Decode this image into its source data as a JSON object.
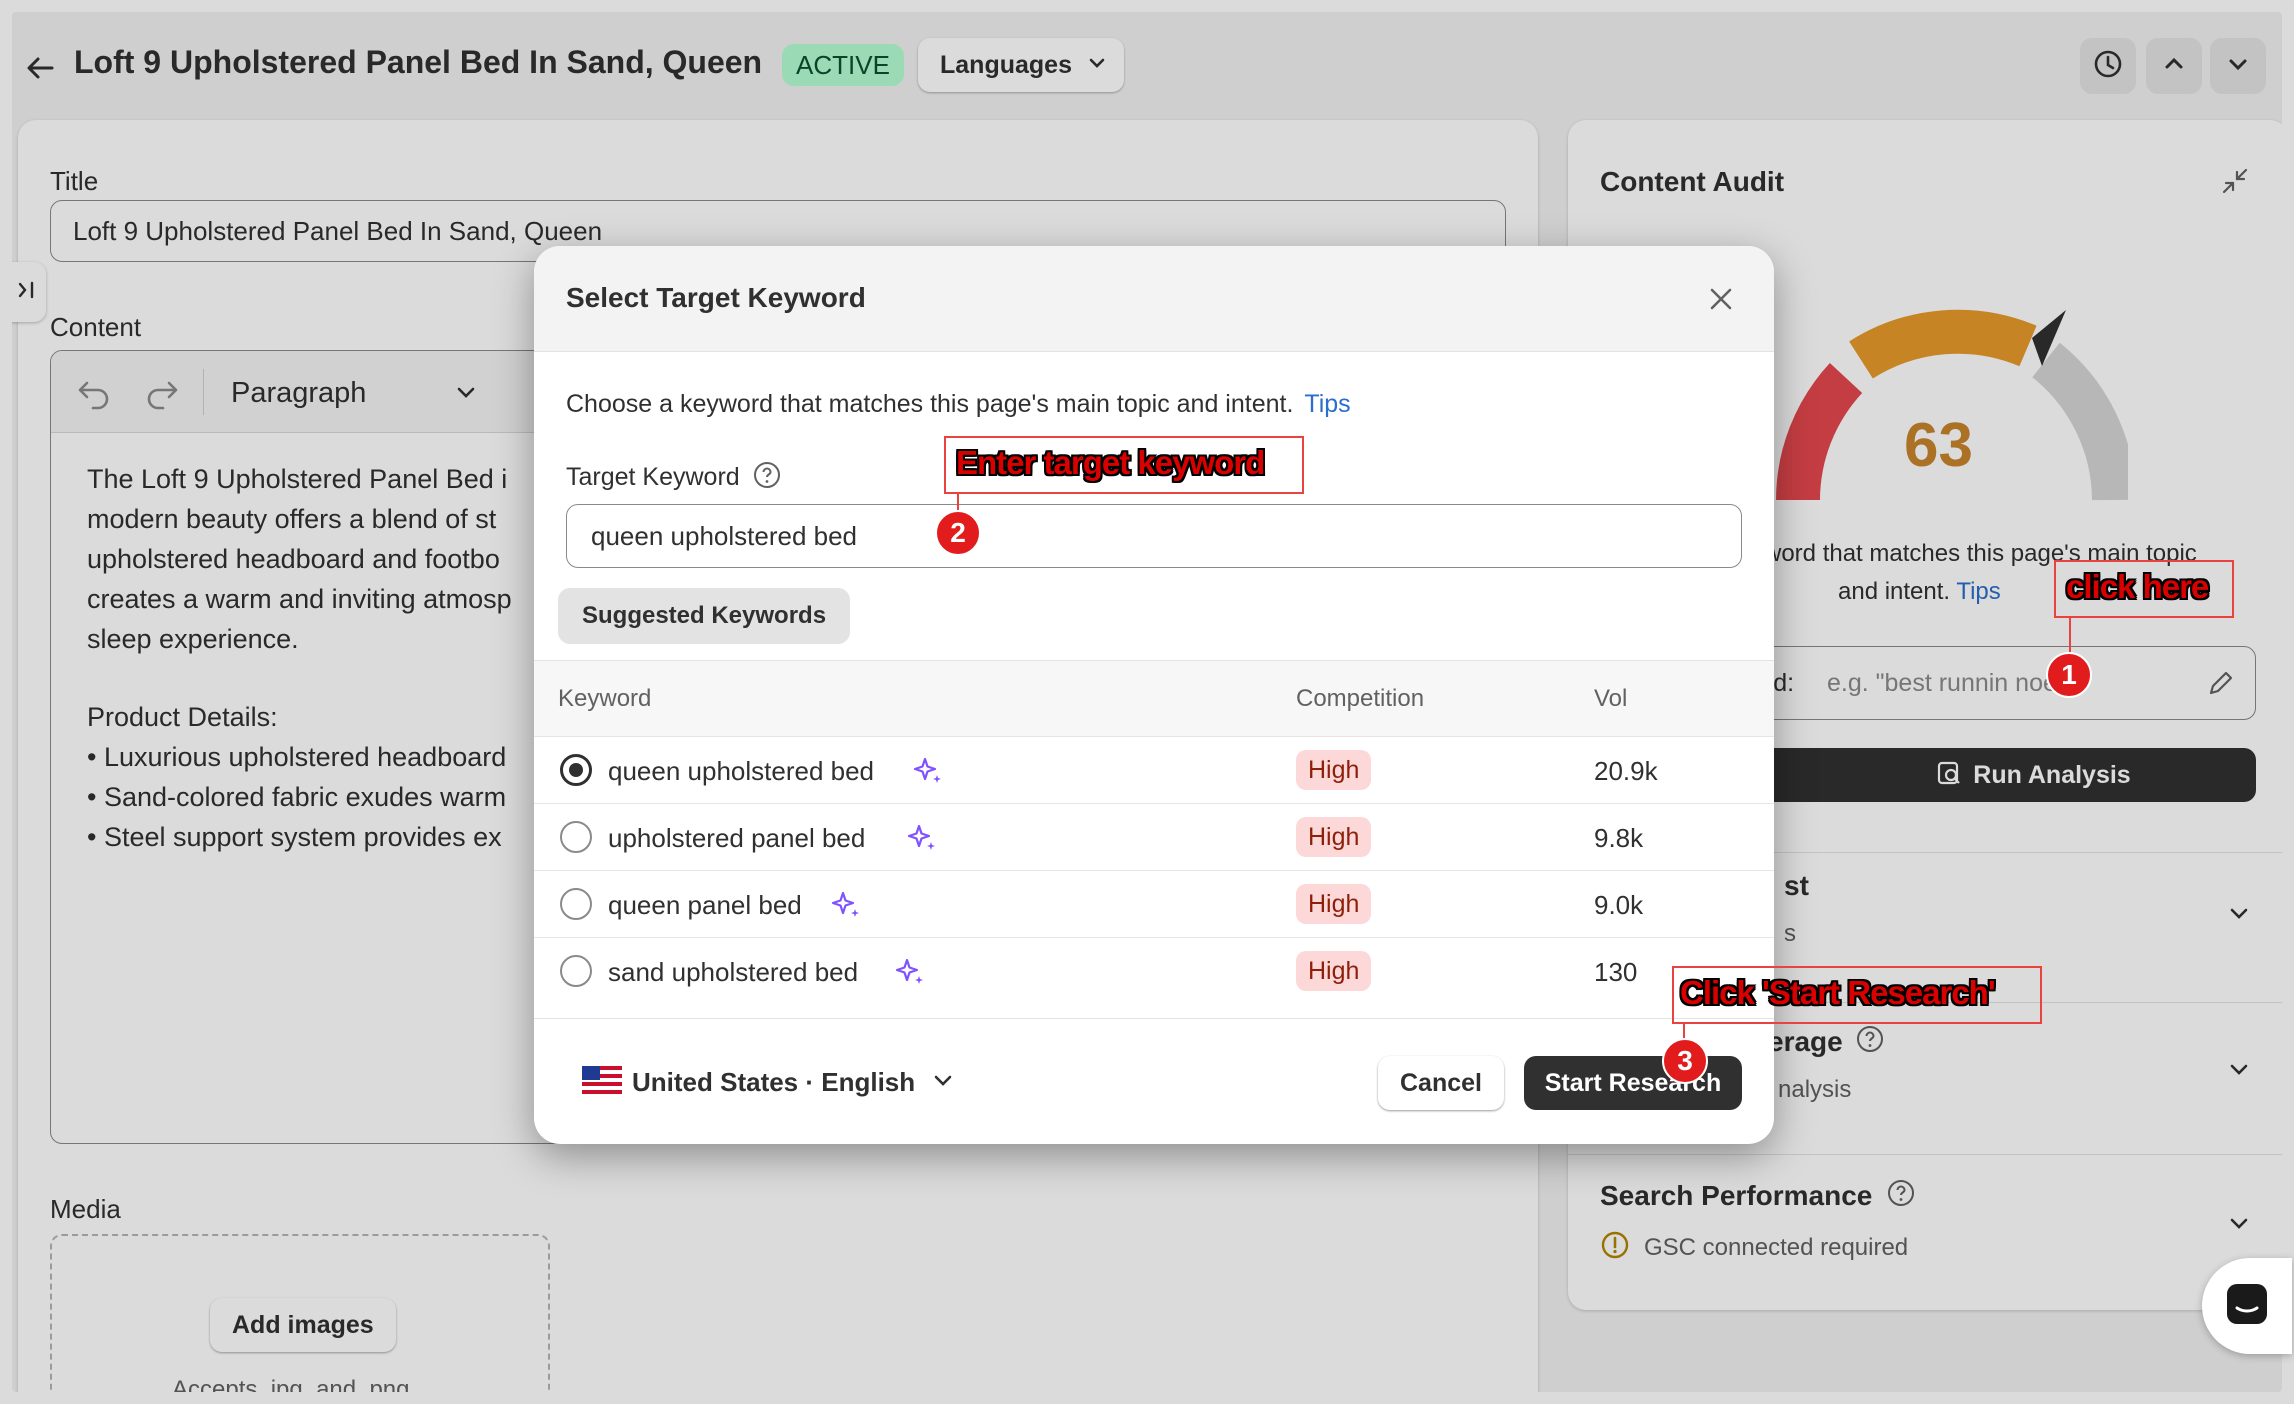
{
  "header": {
    "title": "Loft 9 Upholstered Panel Bed In Sand, Queen",
    "status_badge": "ACTIVE",
    "languages_label": "Languages"
  },
  "editor": {
    "title_label": "Title",
    "title_value": "Loft 9 Upholstered Panel Bed In Sand, Queen",
    "content_label": "Content",
    "paragraph_select": "Paragraph",
    "body_lines": [
      "The Loft 9 Upholstered Panel Bed i",
      "modern beauty offers a blend of st",
      "upholstered headboard and footbo",
      "creates a warm and inviting atmosp",
      "sleep experience."
    ],
    "details_heading": "Product Details:",
    "detail_lines": [
      "• Luxurious upholstered headboard",
      "• Sand-colored fabric exudes warm",
      "• Steel support system provides ex"
    ],
    "media_label": "Media",
    "add_images_label": "Add images",
    "accepts_text": "Accepts .jpg, and .png"
  },
  "audit": {
    "title": "Content Audit",
    "score": "63",
    "desc_line1": "word that matches this page's main topic",
    "desc_line2": "and intent.",
    "tips_link": "Tips",
    "keyword_label": "ord:",
    "keyword_placeholder": "e.g. \"best runnin   noes\"",
    "run_analysis_label": "Run Analysis",
    "section1_title": "st",
    "section1_sub": "s",
    "section2_title": "erage",
    "section2_sub": "nalysis",
    "search_perf_title": "Search Performance",
    "gsc_text": "GSC connected required"
  },
  "modal": {
    "title": "Select Target Keyword",
    "description": "Choose a keyword that matches this page's main topic and intent.",
    "tips_link": "Tips",
    "target_label": "Target Keyword",
    "target_value": "queen upholstered bed",
    "suggested_label": "Suggested Keywords",
    "columns": [
      "Keyword",
      "Competition",
      "Vol"
    ],
    "rows": [
      {
        "keyword": "queen upholstered bed",
        "competition": "High",
        "vol": "20.9k",
        "selected": true
      },
      {
        "keyword": "upholstered panel bed",
        "competition": "High",
        "vol": "9.8k",
        "selected": false
      },
      {
        "keyword": "queen panel bed",
        "competition": "High",
        "vol": "9.0k",
        "selected": false
      },
      {
        "keyword": "sand upholstered bed",
        "competition": "High",
        "vol": "130",
        "selected": false
      }
    ],
    "locale_label": "United States · English",
    "cancel_label": "Cancel",
    "start_label": "Start Research"
  },
  "annotations": {
    "step1_text": "click here",
    "step2_text": "Enter target keyword",
    "step3_text": "Click 'Start Research'",
    "step1_num": "1",
    "step2_num": "2",
    "step3_num": "3"
  },
  "colors": {
    "active_badge": "#b4fed2",
    "gauge_red": "#e5484d",
    "gauge_orange": "#e89a2c",
    "gauge_grey": "#d6d6d6",
    "score": "#c8842a",
    "link": "#2c6ecb",
    "annotation_red": "#d90000"
  }
}
